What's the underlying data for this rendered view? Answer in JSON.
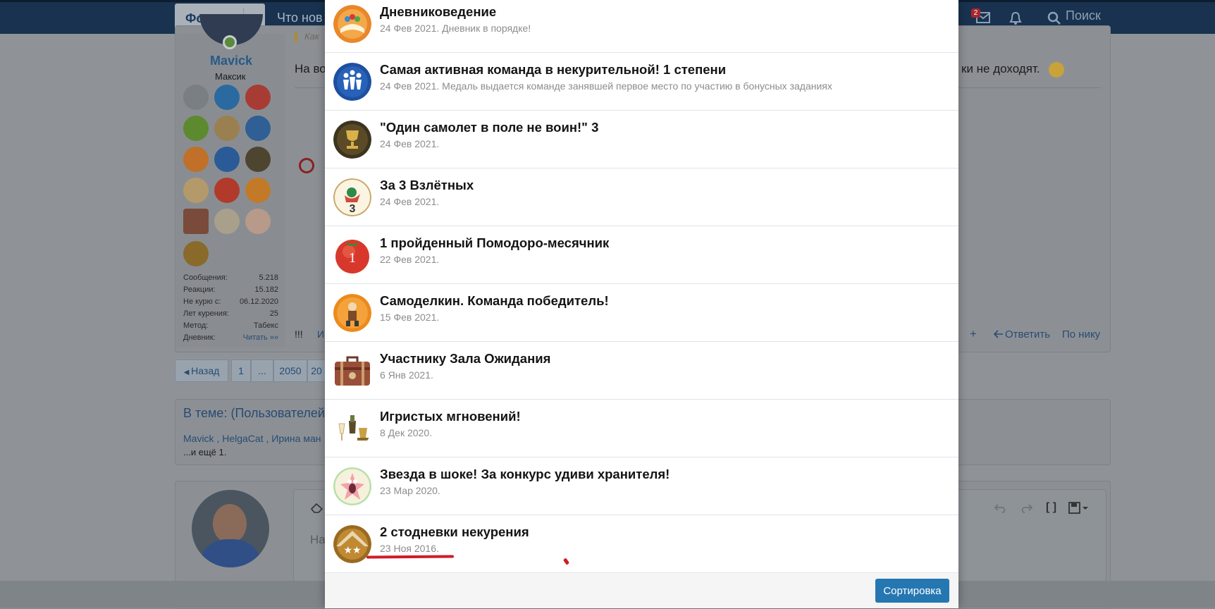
{
  "header": {
    "forums_label": "Форумы",
    "whatsnew_label": "Что нов",
    "unread_badge": "2",
    "search_label": "Поиск"
  },
  "user": {
    "name": "Mavick",
    "title": "Максик",
    "stats": [
      {
        "label": "Сообщения:",
        "value": "5.218"
      },
      {
        "label": "Реакции:",
        "value": "15.182"
      },
      {
        "label": "Не курю с:",
        "value": "06.12.2020"
      },
      {
        "label": "Лет курения:",
        "value": "25"
      },
      {
        "label": "Метод:",
        "value": "Табекс"
      },
      {
        "label": "Дневник:",
        "value": "Читать »»"
      }
    ]
  },
  "post": {
    "text_left": "На во",
    "text_right": "ки не доходят.",
    "quote_hint": "Как",
    "actions": {
      "exclaim": "!!!",
      "i": "И",
      "plus": "+",
      "reply": "Ответить",
      "by_nick": "По нику"
    }
  },
  "pager": {
    "back": "Назад",
    "p1": "1",
    "dots": "...",
    "p2050": "2050",
    "p20": "20"
  },
  "thread_users": {
    "heading": "В теме: (Пользователей",
    "names": "Mavick , HelgaCat , Ирина ман",
    "more": "...и ещё 1."
  },
  "editor": {
    "placeholder_hint": "На"
  },
  "modal": {
    "items": [
      {
        "title": "Дневниковедение",
        "desc": "24 Фев 2021. Дневник в порядке!",
        "icon": "diary-medal-icon"
      },
      {
        "title": "Самая активная команда в некурительной! 1 степени",
        "desc": "24 Фев 2021. Медаль выдается команде занявшей первое место по участию в бонусных заданиях",
        "icon": "team-medal-icon"
      },
      {
        "title": "\"Один самолет в поле не воин!\" 3",
        "desc": "24 Фев 2021.",
        "icon": "trophy-medal-icon"
      },
      {
        "title": "За 3 Взлётных",
        "desc": "24 Фев 2021.",
        "icon": "takeoff-medal-icon"
      },
      {
        "title": "1 пройденный Помодоро-месячник",
        "desc": "22 Фев 2021.",
        "icon": "tomato-medal-icon"
      },
      {
        "title": "Самоделкин. Команда победитель!",
        "desc": "15 Фев 2021.",
        "icon": "samodelkin-medal-icon"
      },
      {
        "title": "Участнику Зала Ожидания",
        "desc": "6 Янв 2021.",
        "icon": "suitcase-medal-icon"
      },
      {
        "title": "Игристых мгновений!",
        "desc": "8 Дек 2020.",
        "icon": "champagne-medal-icon"
      },
      {
        "title": "Звезда в шоке! За конкурс удиви хранителя!",
        "desc": "23 Мар 2020.",
        "icon": "starfish-medal-icon"
      },
      {
        "title": "2 стодневки некурения",
        "desc": "23 Ноя 2016.",
        "icon": "stars-medal-icon"
      }
    ],
    "sort_button": "Сортировка"
  },
  "colors": {
    "accent": "#2577b1",
    "nav": "#18324f",
    "annotation": "#d01c24"
  }
}
